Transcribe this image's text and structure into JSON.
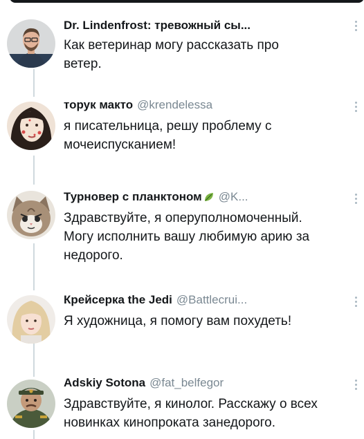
{
  "tweets": [
    {
      "author": "Dr. Lindenfrost: тревожный сы...",
      "handle": "",
      "text": "Как ветеринар могу рассказать про\nветер.",
      "avatar_icon": "man-with-glasses-avatar"
    },
    {
      "author": "торук макто",
      "handle": "@krendelessa",
      "text": "я писательница, решу проблему с\nмочеиспусканием!",
      "avatar_icon": "woman-face-avatar"
    },
    {
      "author": "Турновер с планктоном",
      "handle": "@K...",
      "text": "Здравствуйте, я оперуполномоченный.\nМогу исполнить вашу любимую арию за\nнедорого.",
      "avatar_icon": "angry-kitten-avatar",
      "badge_icon": "leaf-emoji-icon"
    },
    {
      "author": "Крейсерка the Jedi",
      "handle": "@Battlecrui...",
      "text": "Я художница, я помогу вам похудеть!",
      "avatar_icon": "blonde-woman-avatar"
    },
    {
      "author": "Adskiy Sotona",
      "handle": "@fat_belfegor",
      "text": "Здравствуйте, я кинолог. Расскажу о всех\nновинках кинопроката занедорого.",
      "avatar_icon": "military-figure-avatar"
    }
  ],
  "colors": {
    "text": "#14171a",
    "secondary": "#7a8892",
    "thread_line": "#cfd9de"
  }
}
